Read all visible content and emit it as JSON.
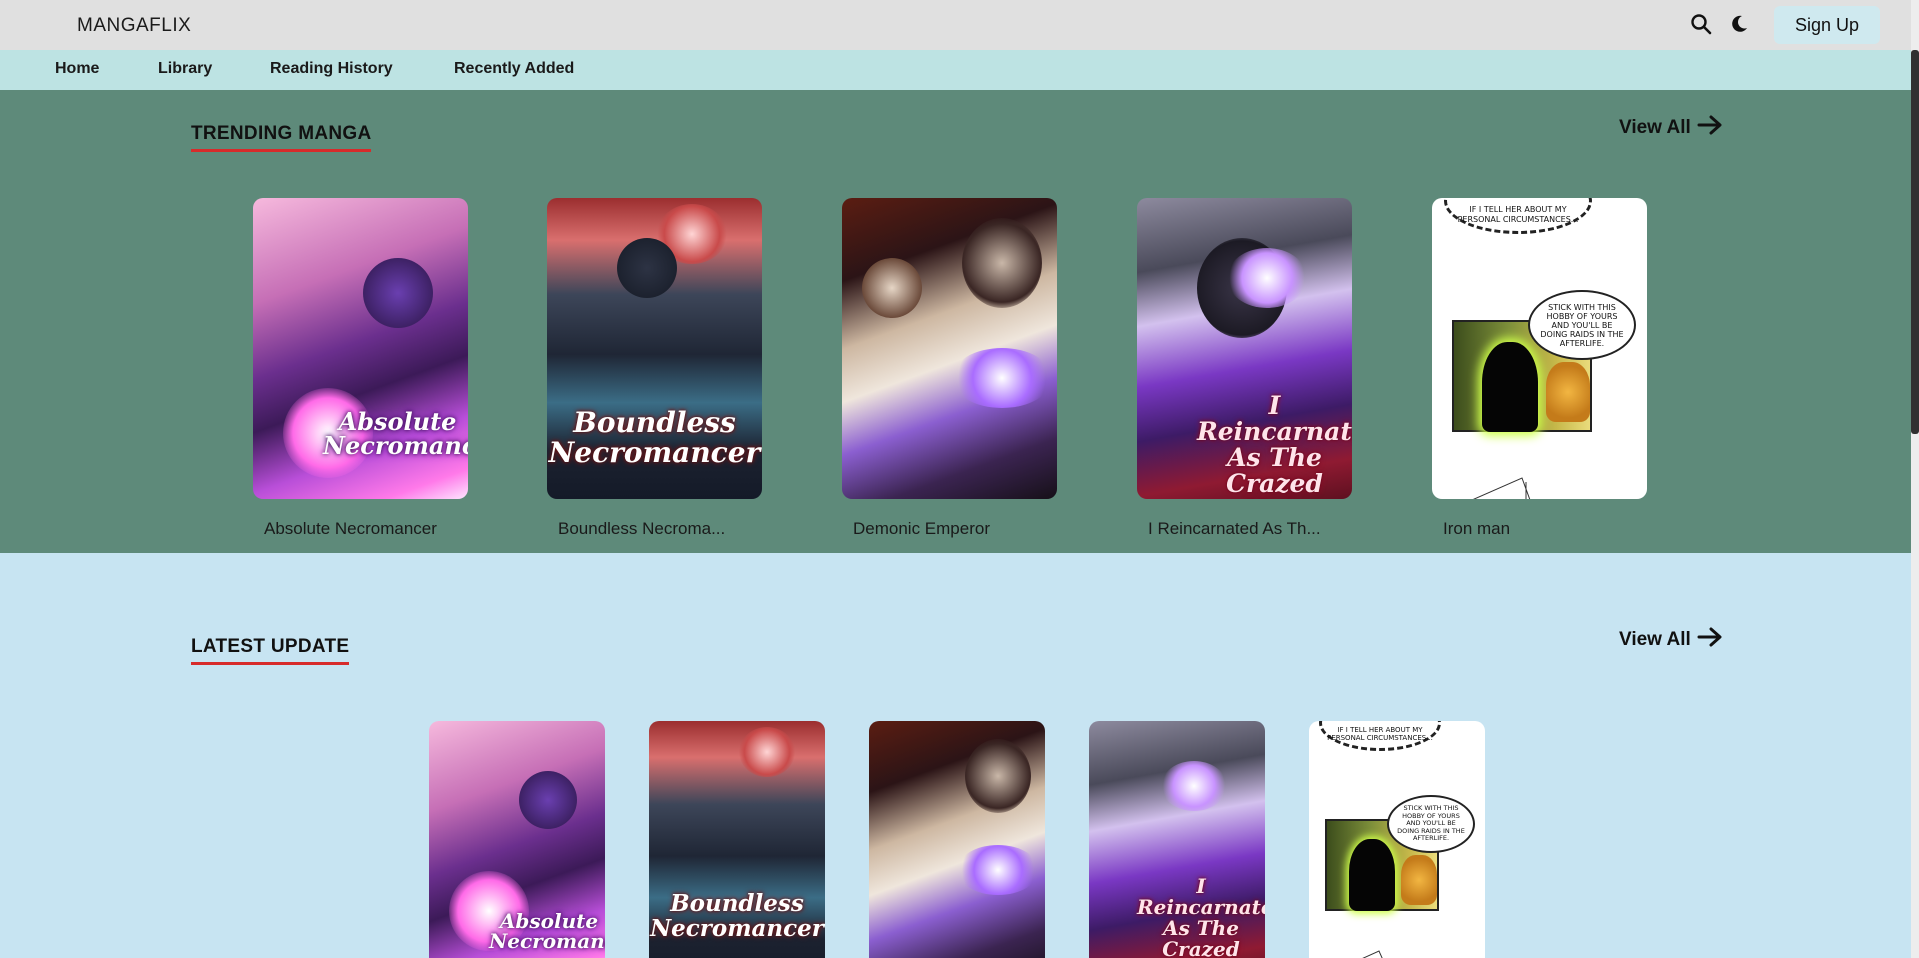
{
  "header": {
    "brand": "MANGAFLIX",
    "signup_label": "Sign Up"
  },
  "icons": {
    "search": "search-icon",
    "theme": "moon-icon",
    "arrow": "arrow-right-icon"
  },
  "nav": {
    "items": [
      {
        "label": "Home"
      },
      {
        "label": "Library"
      },
      {
        "label": "Reading History"
      },
      {
        "label": "Recently Added"
      }
    ]
  },
  "trending": {
    "title": "TRENDING MANGA",
    "view_all": "View All",
    "items": [
      {
        "title": "Absolute Necromancer",
        "cover_text": "Absolute Necromancer"
      },
      {
        "title": "Boundless Necroma...",
        "cover_text": "Boundless Necromancer"
      },
      {
        "title": "Demonic Emperor"
      },
      {
        "title": "I Reincarnated As Th...",
        "cover_text": "I Reincarnated As The Crazed Heir"
      },
      {
        "title": "Iron man",
        "cover_bubble_top": "IF I TELL HER ABOUT MY PERSONAL CIRCUMSTANCES...",
        "cover_bubble": "STICK WITH THIS HOBBY OF YOURS AND YOU'LL BE DOING RAIDS IN THE AFTERLIFE."
      }
    ]
  },
  "latest": {
    "title": "LATEST UPDATE",
    "view_all": "View All",
    "items": [
      {
        "cover_text": "Absolute Necromancer"
      },
      {
        "cover_text": "Boundless Necromancer"
      },
      {
        "cover_text": ""
      },
      {
        "cover_text": "I Reincarnated As The Crazed Heir"
      },
      {
        "cover_bubble_top": "IF I TELL HER ABOUT MY PERSONAL CIRCUMSTANCES...",
        "cover_bubble": "STICK WITH THIS HOBBY OF YOURS AND YOU'LL BE DOING RAIDS IN THE AFTERLIFE."
      }
    ]
  },
  "colors": {
    "topbar": "#e0e0e0",
    "navbar": "#bde3e3",
    "trending_bg": "#5e8a7a",
    "latest_bg": "#c7e4f2",
    "accent_underline": "#d72b2b"
  }
}
